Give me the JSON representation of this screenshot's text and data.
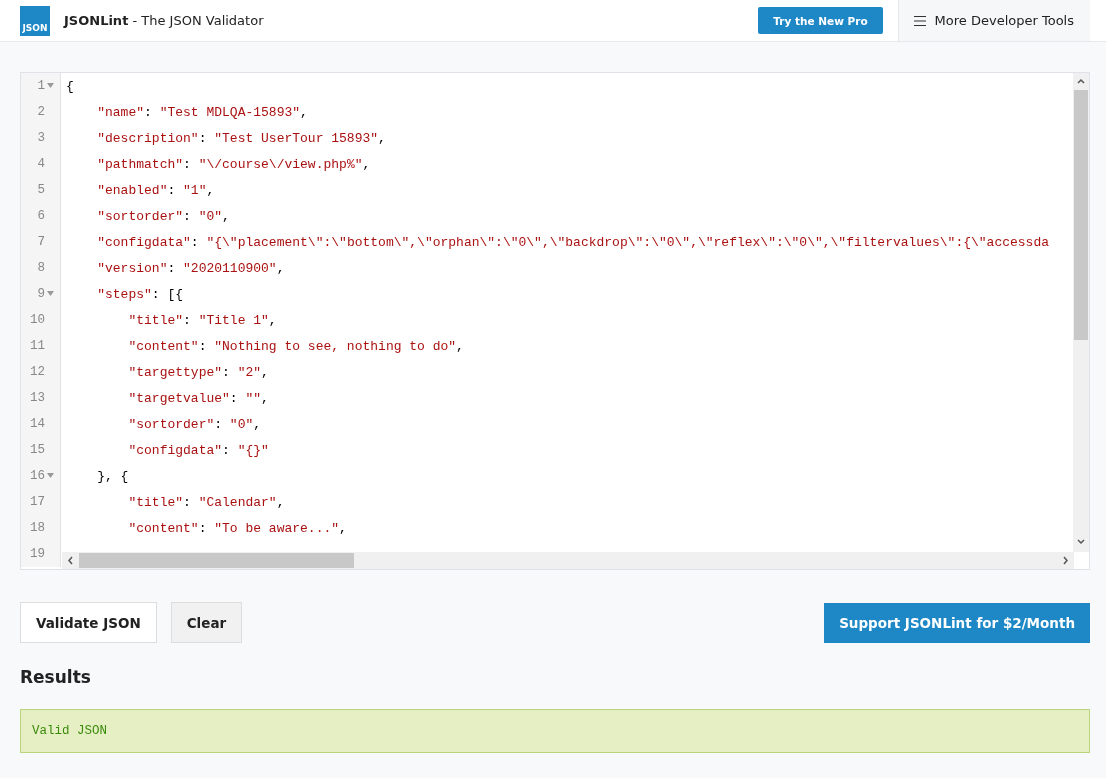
{
  "header": {
    "logo_text": "JSON",
    "title": "**JSONLint** - The JSON Validator",
    "pro_button": "Try the New Pro",
    "tools_menu": "More Developer Tools"
  },
  "editor": {
    "lines": [
      {
        "number": "1",
        "foldable": true,
        "code": "{"
      },
      {
        "number": "2",
        "foldable": false,
        "code": "    \"name\": \"Test MDLQA-15893\","
      },
      {
        "number": "3",
        "foldable": false,
        "code": "    \"description\": \"Test UserTour 15893\","
      },
      {
        "number": "4",
        "foldable": false,
        "code": "    \"pathmatch\": \"\\/course\\/view.php%\","
      },
      {
        "number": "5",
        "foldable": false,
        "code": "    \"enabled\": \"1\","
      },
      {
        "number": "6",
        "foldable": false,
        "code": "    \"sortorder\": \"0\","
      },
      {
        "number": "7",
        "foldable": false,
        "code": "    \"configdata\": \"{\\\"placement\\\":\\\"bottom\\\",\\\"orphan\\\":\\\"0\\\",\\\"backdrop\\\":\\\"0\\\",\\\"reflex\\\":\\\"0\\\",\\\"filtervalues\\\":{\\\"accessda"
      },
      {
        "number": "8",
        "foldable": false,
        "code": "    \"version\": \"2020110900\","
      },
      {
        "number": "9",
        "foldable": true,
        "code": "    \"steps\": [{"
      },
      {
        "number": "10",
        "foldable": false,
        "code": "        \"title\": \"Title 1\","
      },
      {
        "number": "11",
        "foldable": false,
        "code": "        \"content\": \"Nothing to see, nothing to do\","
      },
      {
        "number": "12",
        "foldable": false,
        "code": "        \"targettype\": \"2\","
      },
      {
        "number": "13",
        "foldable": false,
        "code": "        \"targetvalue\": \"\","
      },
      {
        "number": "14",
        "foldable": false,
        "code": "        \"sortorder\": \"0\","
      },
      {
        "number": "15",
        "foldable": false,
        "code": "        \"configdata\": \"{}\""
      },
      {
        "number": "16",
        "foldable": true,
        "code": "    }, {"
      },
      {
        "number": "17",
        "foldable": false,
        "code": "        \"title\": \"Calendar\","
      },
      {
        "number": "18",
        "foldable": false,
        "code": "        \"content\": \"To be aware...\","
      },
      {
        "number": "19",
        "foldable": false
      }
    ]
  },
  "actions": {
    "validate": "Validate JSON",
    "clear": "Clear",
    "support": "Support JSONLint for $2/Month"
  },
  "results": {
    "heading": "Results",
    "message": "Valid JSON"
  }
}
